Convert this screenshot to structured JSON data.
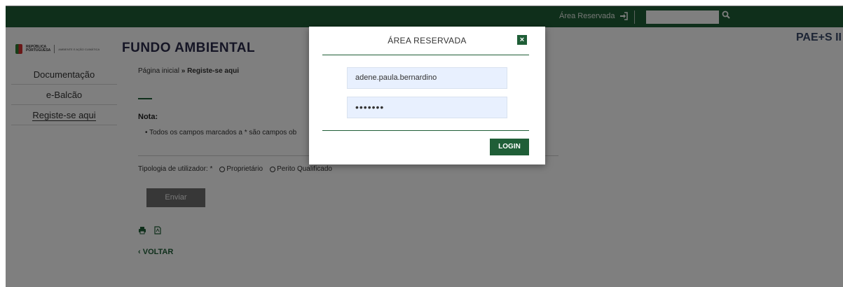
{
  "topbar": {
    "reserved_label": "Área Reservada",
    "login_icon": "sign-in-icon",
    "search_icon": "search-icon"
  },
  "header": {
    "rep_line1": "REPÚBLICA",
    "rep_line2": "PORTUGUESA",
    "rep_sub": "AMBIENTE E AÇÃO CLIMÁTICA",
    "brand": "FUNDO AMBIENTAL",
    "right_title": "PAE+S II"
  },
  "sidebar": {
    "items": [
      {
        "label": "Documentação"
      },
      {
        "label": "e-Balcão"
      },
      {
        "label": "Registe-se aqui"
      }
    ]
  },
  "main": {
    "breadcrumb_home": "Página inicial",
    "breadcrumb_sep": " » ",
    "breadcrumb_current": "Registe-se aqui",
    "nota_label": "Nota:",
    "bullet_text": "•  Todos os campos marcados a * são campos ob",
    "tipologia_label": "Tipologia de utilizador: *",
    "radio_1": "Proprietário",
    "radio_2": "Perito Qualificado",
    "submit_label": "Enviar",
    "back_label": "VOLTAR"
  },
  "modal": {
    "title": "ÁREA RESERVADA",
    "close_label": "×",
    "username_value": "adene.paula.bernardino",
    "password_value": "•••••••",
    "login_label": "LOGIN"
  },
  "colors": {
    "brand_green": "#1f5e37",
    "overlay": "rgba(0,0,0,0.5)"
  }
}
